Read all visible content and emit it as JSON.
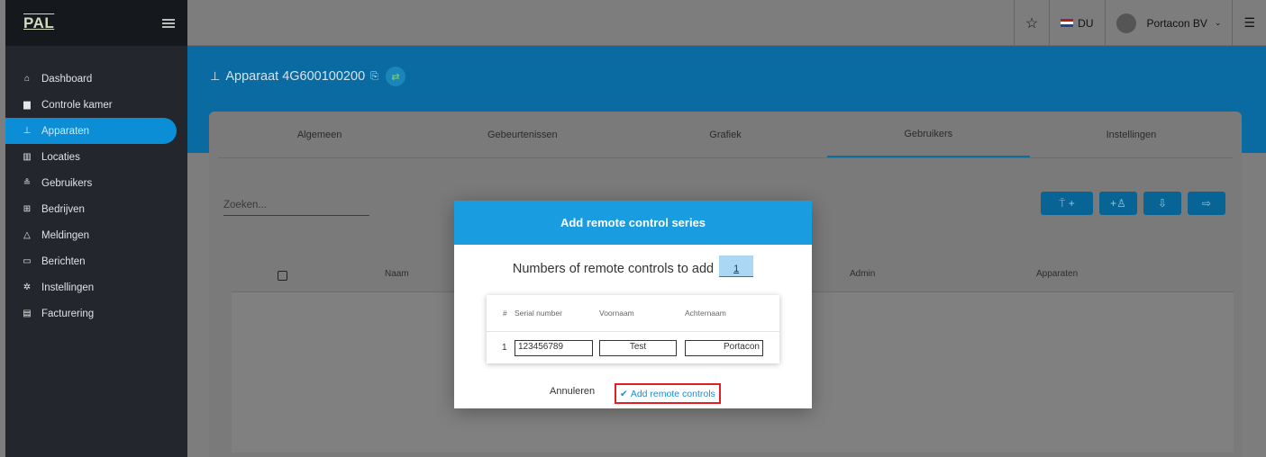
{
  "sidebar": {
    "logo": "PAL",
    "items": [
      {
        "label": "Dashboard",
        "icon": "⌂"
      },
      {
        "label": "Controle kamer",
        "icon": "▆"
      },
      {
        "label": "Apparaten",
        "icon": "⊥"
      },
      {
        "label": "Locaties",
        "icon": "▥"
      },
      {
        "label": "Gebruikers",
        "icon": "≗"
      },
      {
        "label": "Bedrijven",
        "icon": "⊞"
      },
      {
        "label": "Meldingen",
        "icon": "△"
      },
      {
        "label": "Berichten",
        "icon": "▭"
      },
      {
        "label": "Instellingen",
        "icon": "✲"
      },
      {
        "label": "Facturering",
        "icon": "▤"
      }
    ]
  },
  "topbar": {
    "language": "DU",
    "account": "Portacon BV"
  },
  "device": {
    "title": "Apparaat 4G600100200"
  },
  "tabs": [
    "Algemeen",
    "Gebeurtenissen",
    "Grafiek",
    "Gebruikers",
    "Instellingen"
  ],
  "search": {
    "placeholder": "Zoeken..."
  },
  "table": {
    "columns": [
      "Naam",
      "Admin",
      "Apparaten"
    ]
  },
  "modal": {
    "title": "Add remote control series",
    "count_label": "Numbers of remote controls to add",
    "count_value": "1",
    "headers": [
      "#",
      "Serial number",
      "Voornaam",
      "Achternaam"
    ],
    "row": {
      "index": "1",
      "serial": "123456789",
      "firstname": "Test",
      "lastname": "Portacon"
    },
    "cancel": "Annuleren",
    "confirm": "Add remote controls"
  }
}
